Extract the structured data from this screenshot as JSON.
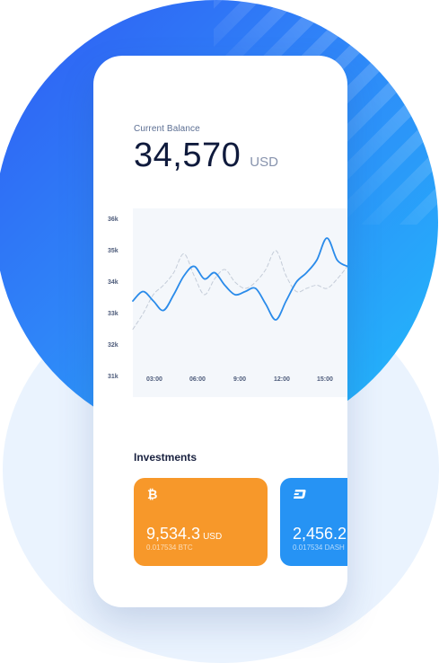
{
  "balance": {
    "label": "Current Balance",
    "value": "34,570",
    "unit": "USD"
  },
  "chart_data": {
    "type": "line",
    "y_ticks": [
      "36k",
      "35k",
      "34k",
      "33k",
      "32k",
      "31k"
    ],
    "x_ticks": [
      "03:00",
      "06:00",
      "9:00",
      "12:00",
      "15:00"
    ],
    "ylim": [
      31,
      36
    ],
    "series": [
      {
        "style": "solid",
        "color": "#2a8bea",
        "points": [
          [
            0.0,
            33.4
          ],
          [
            0.4,
            33.7
          ],
          [
            0.8,
            33.4
          ],
          [
            1.2,
            33.1
          ],
          [
            1.6,
            33.6
          ],
          [
            2.0,
            34.2
          ],
          [
            2.4,
            34.5
          ],
          [
            2.8,
            34.1
          ],
          [
            3.2,
            34.3
          ],
          [
            3.6,
            33.9
          ],
          [
            4.0,
            33.6
          ],
          [
            4.4,
            33.7
          ],
          [
            4.8,
            33.8
          ],
          [
            5.2,
            33.3
          ],
          [
            5.6,
            32.8
          ],
          [
            6.0,
            33.4
          ],
          [
            6.4,
            34.0
          ],
          [
            6.8,
            34.3
          ],
          [
            7.2,
            34.7
          ],
          [
            7.6,
            35.4
          ],
          [
            8.0,
            34.7
          ],
          [
            8.4,
            34.5
          ]
        ]
      },
      {
        "style": "dashed",
        "color": "#c4ccd8",
        "points": [
          [
            0.0,
            32.5
          ],
          [
            0.4,
            33.0
          ],
          [
            0.8,
            33.6
          ],
          [
            1.2,
            33.9
          ],
          [
            1.6,
            34.3
          ],
          [
            2.0,
            34.9
          ],
          [
            2.4,
            34.2
          ],
          [
            2.8,
            33.6
          ],
          [
            3.2,
            34.1
          ],
          [
            3.6,
            34.4
          ],
          [
            4.0,
            34.0
          ],
          [
            4.4,
            33.8
          ],
          [
            4.8,
            34.0
          ],
          [
            5.2,
            34.4
          ],
          [
            5.6,
            35.0
          ],
          [
            6.0,
            34.2
          ],
          [
            6.4,
            33.7
          ],
          [
            6.8,
            33.8
          ],
          [
            7.2,
            33.9
          ],
          [
            7.6,
            33.8
          ],
          [
            8.0,
            34.1
          ],
          [
            8.4,
            34.5
          ]
        ]
      }
    ]
  },
  "investments": {
    "title": "Investments",
    "cards": [
      {
        "icon": "bitcoin-icon",
        "value": "9,534.3",
        "unit": "USD",
        "sub": "0.017534 BTC",
        "color": "#f7982a"
      },
      {
        "icon": "dash-icon",
        "value": "2,456.2",
        "unit": "",
        "sub": "0.017534 DASH",
        "color": "#2693f4"
      }
    ]
  },
  "colors": {
    "accent": "#2a8bea",
    "background_gradient": [
      "#2f5cf3",
      "#21bdfb"
    ]
  }
}
